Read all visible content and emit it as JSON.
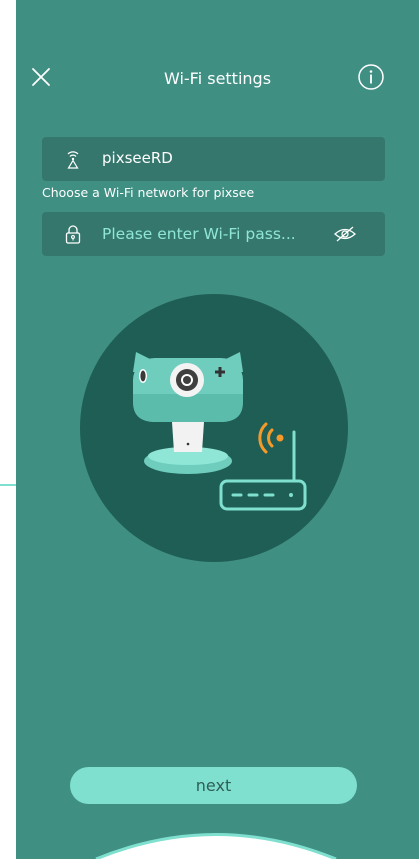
{
  "header": {
    "title": "Wi-Fi settings",
    "close_icon": "close-icon",
    "info_icon": "info-icon"
  },
  "wifi": {
    "ssid_value": "pixseeRD",
    "ssid_icon": "wifi-antenna-icon",
    "hint": "Choose a Wi-Fi network for pixsee",
    "password_placeholder": "Please enter Wi-Fi pass...",
    "password_value": "",
    "lock_icon": "lock-icon",
    "visibility_icon": "eye-hidden-icon"
  },
  "illustration": {
    "camera_icon": "baby-camera-illustration",
    "router_icon": "router-illustration",
    "signal_icon": "wifi-signal-icon"
  },
  "actions": {
    "next_label": "next"
  },
  "colors": {
    "background": "#3f8f83",
    "field": "#35776d",
    "accent": "#7fe0cf",
    "circle": "#1f5e55",
    "signal": "#f59a2a"
  }
}
